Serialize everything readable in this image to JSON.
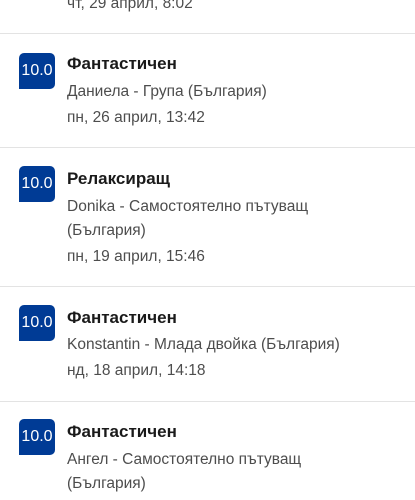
{
  "reviews": [
    {
      "date": "чт, 29 април, 8:02"
    },
    {
      "score": "10.0",
      "title": "Фантастичен",
      "reviewer": "Даниела - Група (България)",
      "date": "пн, 26 април, 13:42"
    },
    {
      "score": "10.0",
      "title": "Релаксиращ",
      "reviewer": "Donika - Самостоятелно пътуващ",
      "reviewer_line2": "(България)",
      "date": "пн, 19 април, 15:46"
    },
    {
      "score": "10.0",
      "title": "Фантастичен",
      "reviewer": "Konstantin - Млада двойка (България)",
      "date": "нд, 18 април, 14:18"
    },
    {
      "score": "10.0",
      "title": "Фантастичен",
      "reviewer": "Ангел - Самостоятелно пътуващ",
      "reviewer_line2": "(България)"
    }
  ],
  "colors": {
    "badge": "#003b95",
    "divider": "#e3e3e3",
    "secondary_text": "#4d4d4d"
  }
}
